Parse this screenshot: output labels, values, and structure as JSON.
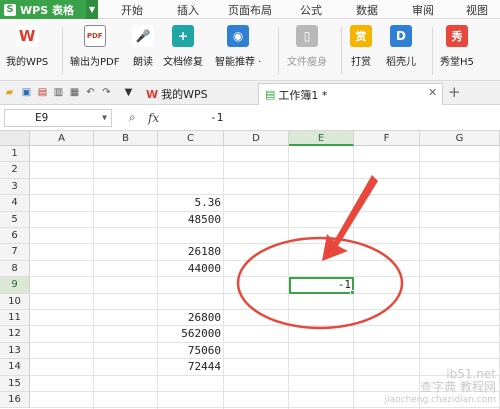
{
  "app": {
    "name": "WPS 表格",
    "logo": "S"
  },
  "menu": [
    "开始",
    "插入",
    "页面布局",
    "公式",
    "数据",
    "审阅",
    "视图"
  ],
  "ribbon": {
    "buttons": [
      {
        "label": "我的WPS",
        "icon": "wps-logo-icon",
        "glyph": "W",
        "color": "#e03a2f"
      },
      {
        "label": "输出为PDF",
        "icon": "pdf-export-icon",
        "glyph": "PDF",
        "color": "#d9d9d9"
      },
      {
        "label": "朗读",
        "icon": "microphone-icon",
        "glyph": "🎤",
        "color": "#f2a23a"
      },
      {
        "label": "文档修复",
        "icon": "document-repair-icon",
        "glyph": "+",
        "color": "#21a6a6"
      },
      {
        "label": "智能推荐 ·",
        "icon": "smart-recommend-icon",
        "glyph": "◉",
        "color": "#2f7fd4"
      },
      {
        "label": "文件瘦身",
        "icon": "file-slim-icon",
        "glyph": "▯",
        "color": "#b8b8b8",
        "disabled": true
      },
      {
        "label": "打赏",
        "icon": "reward-icon",
        "glyph": "赏",
        "color": "#f5b400"
      },
      {
        "label": "稻壳儿",
        "icon": "docer-icon",
        "glyph": "D",
        "color": "#2f7fd4"
      },
      {
        "label": "秀堂H5",
        "icon": "xiutang-icon",
        "glyph": "秀",
        "color": "#e8473c"
      }
    ]
  },
  "tabs": [
    {
      "label": "我的WPS",
      "icon": "wps-logo-icon"
    },
    {
      "label": "工作簿1 *",
      "icon": "sheet-doc-icon",
      "active": true
    }
  ],
  "formula_bar": {
    "name_box": "E9",
    "fx": "fx",
    "value": "-1"
  },
  "columns": [
    "A",
    "B",
    "C",
    "D",
    "E",
    "F",
    "G"
  ],
  "rows": [
    "1",
    "2",
    "3",
    "4",
    "5",
    "6",
    "7",
    "8",
    "9",
    "10",
    "11",
    "12",
    "13",
    "14",
    "15",
    "16"
  ],
  "cells": {
    "C4": "5.36",
    "C5": "48500",
    "C7": "26180",
    "C8": "44000",
    "E9": "-1",
    "C11": "26800",
    "C12": "562000",
    "C13": "75060",
    "C14": "72444"
  },
  "selection": {
    "cell": "E9",
    "column": "E",
    "row": "9"
  },
  "annotation": {
    "color": "#e8473c"
  },
  "watermark": {
    "line1": "ib51.net",
    "line2": "查字典 教程网",
    "line3": "jiaocheng.chazidian.com"
  }
}
